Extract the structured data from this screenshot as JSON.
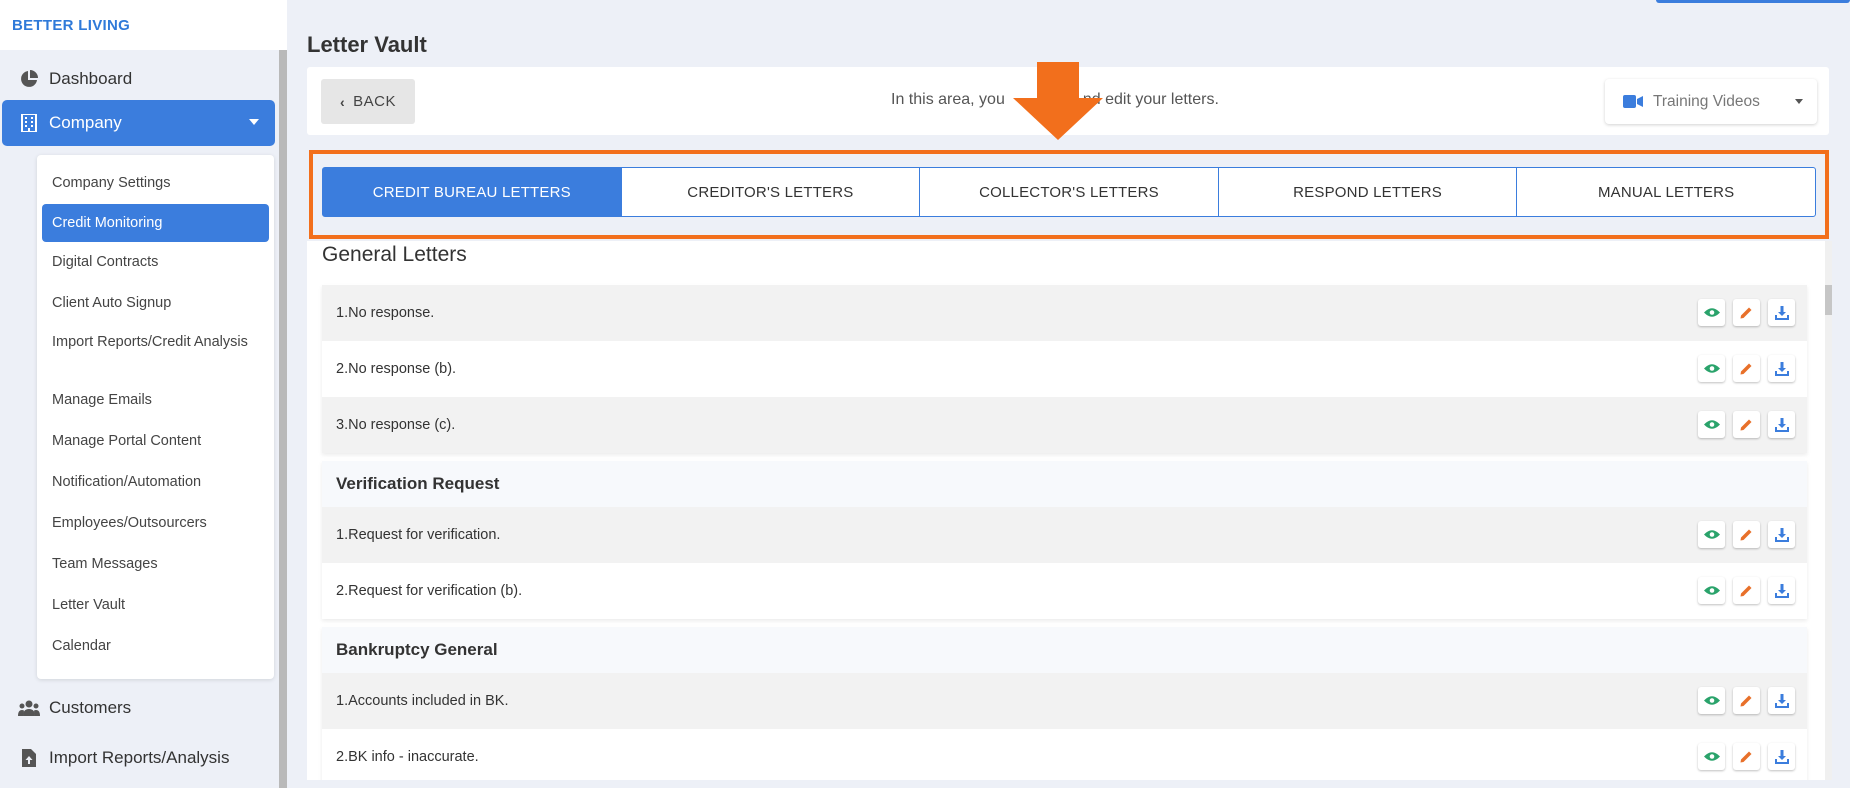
{
  "brand": "BETTER LIVING",
  "nav": {
    "dashboard": "Dashboard",
    "company": "Company",
    "customers": "Customers",
    "import_reports": "Import Reports/Analysis"
  },
  "submenu": [
    {
      "label": "Company Settings"
    },
    {
      "label": "Credit Monitoring"
    },
    {
      "label": "Digital Contracts"
    },
    {
      "label": "Client Auto Signup"
    },
    {
      "label": "Import Reports/Credit Analysis"
    },
    {
      "label": "Manage Emails"
    },
    {
      "label": "Manage Portal Content"
    },
    {
      "label": "Notification/Automation"
    },
    {
      "label": "Employees/Outsourcers"
    },
    {
      "label": "Team Messages"
    },
    {
      "label": "Letter Vault"
    },
    {
      "label": "Calendar"
    }
  ],
  "page": {
    "title": "Letter Vault",
    "back_label": "BACK",
    "intro_left": "In this area, you",
    "intro_right": "nd edit your letters.",
    "training_label": "Training Videos"
  },
  "tabs": [
    {
      "label": "CREDIT BUREAU LETTERS"
    },
    {
      "label": "CREDITOR'S LETTERS"
    },
    {
      "label": "COLLECTOR'S LETTERS"
    },
    {
      "label": "RESPOND LETTERS"
    },
    {
      "label": "MANUAL LETTERS"
    }
  ],
  "groups": [
    {
      "title": "General Letters",
      "rows": [
        "1.No response.",
        "2.No response (b).",
        "3.No response (c)."
      ]
    },
    {
      "title": "Verification Request",
      "rows": [
        "1.Request for verification.",
        "2.Request for verification (b)."
      ]
    },
    {
      "title": "Bankruptcy General",
      "rows": [
        "1.Accounts included in BK.",
        "2.BK info - inaccurate."
      ]
    }
  ],
  "colors": {
    "accent": "#3b7ddd",
    "highlight": "#f26f1c",
    "view_icon": "#2aa36b",
    "edit_icon": "#e8702a",
    "download_icon": "#3b7ddd"
  },
  "icons": {
    "dashboard": "pie-chart-icon",
    "company": "building-icon",
    "customers": "users-icon",
    "import_reports": "file-upload-icon",
    "view": "eye-icon",
    "edit": "pencil-icon",
    "download": "download-icon",
    "training": "video-camera-icon"
  }
}
